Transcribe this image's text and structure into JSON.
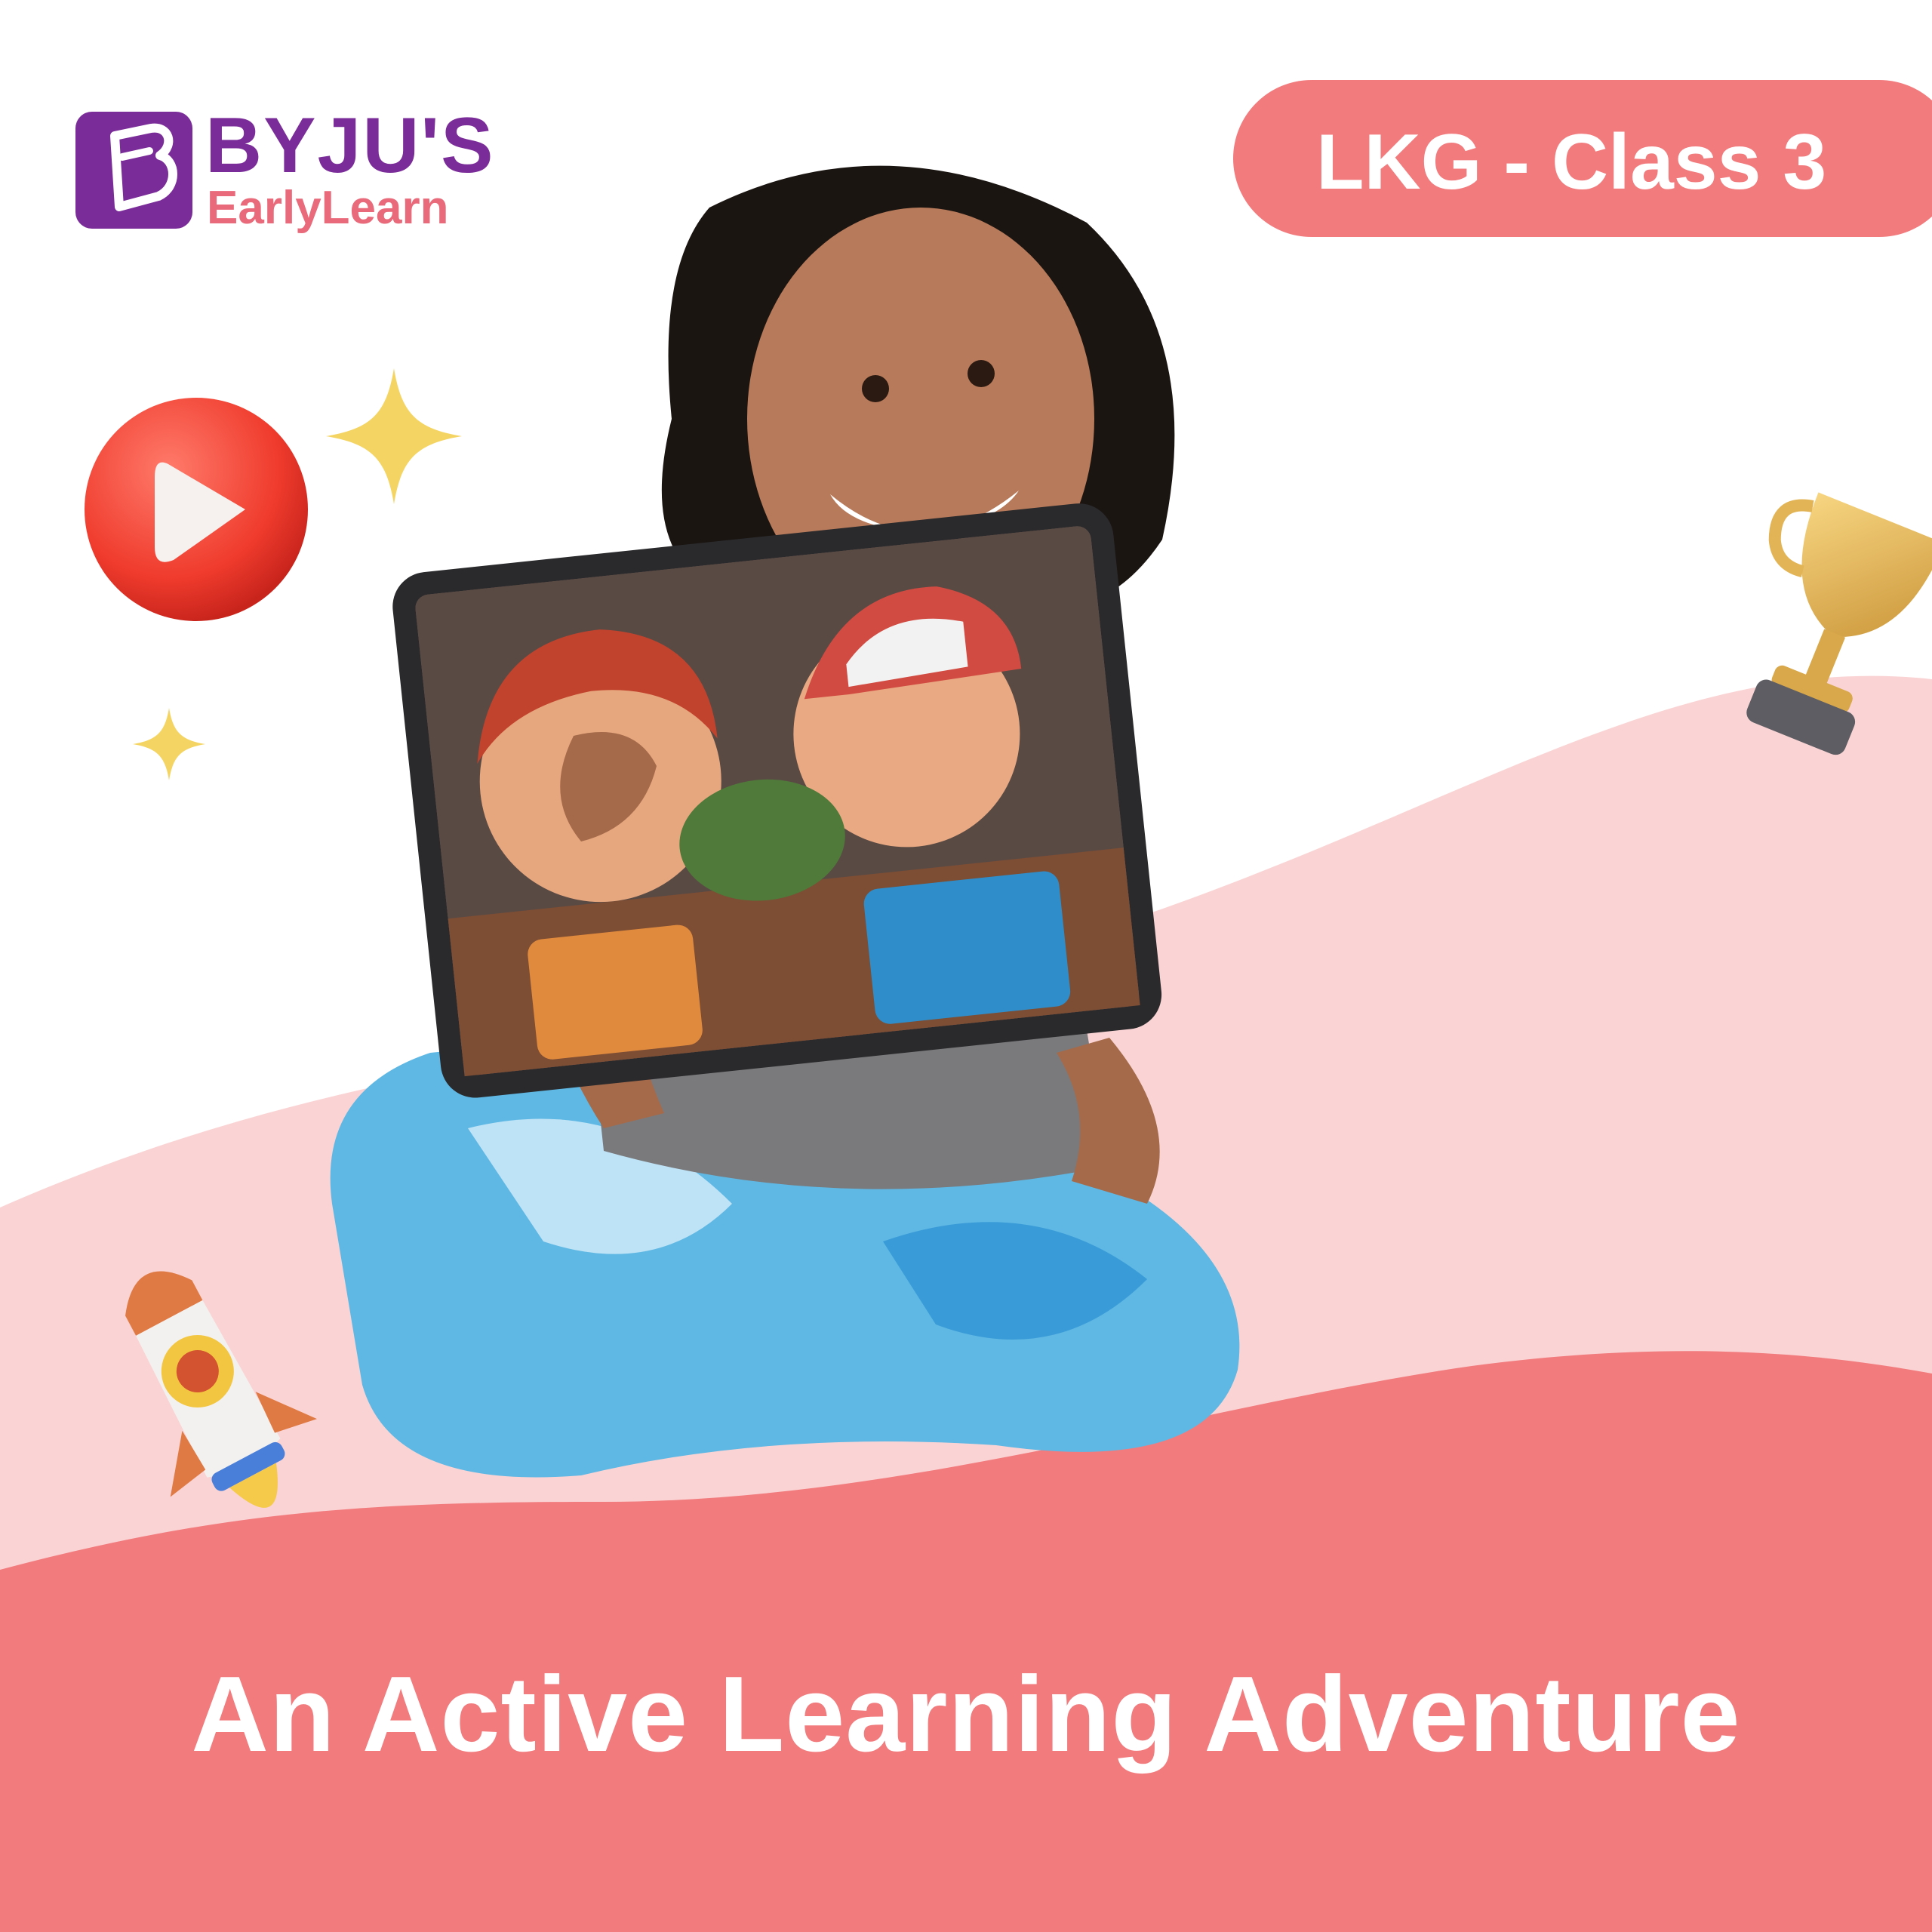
{
  "brand": {
    "name": "BYJU'S",
    "product": "EarlyLearn",
    "colors": {
      "purple": "#7a2c98",
      "coral": "#f27b7e",
      "pink": "#e96a7a"
    }
  },
  "badge": {
    "label": "LKG - Class 3"
  },
  "tagline": "An Active Learning Adventure",
  "icons": [
    "play-button-icon",
    "sparkle-icon",
    "trophy-icon",
    "rocket-icon"
  ],
  "colors": {
    "wave_light": "#fad4d4",
    "wave_dark": "#f27b7e",
    "background": "#ffffff"
  }
}
